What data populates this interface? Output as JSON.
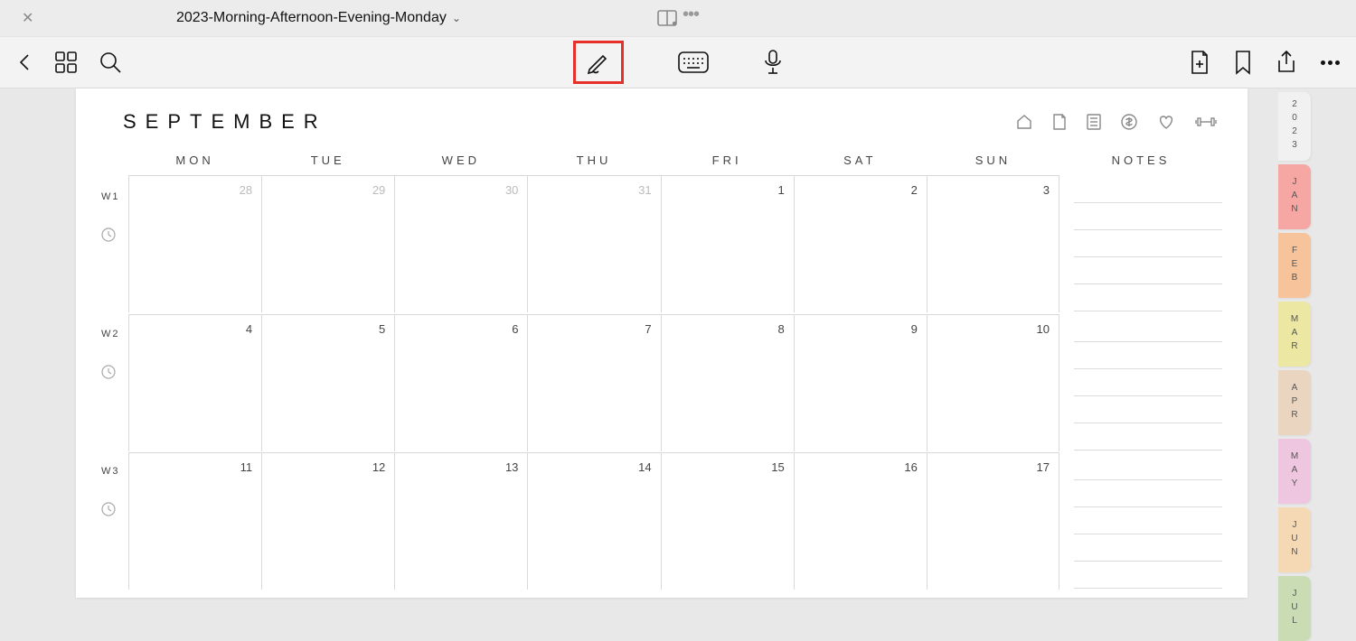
{
  "titlebar": {
    "doc_title": "2023-Morning-Afternoon-Evening-Monday"
  },
  "page": {
    "month_title": "SEPTEMBER",
    "day_headers": [
      "MON",
      "TUE",
      "WED",
      "THU",
      "FRI",
      "SAT",
      "SUN",
      "NOTES"
    ],
    "weeks": [
      {
        "label": "W1",
        "days": [
          {
            "n": "28",
            "prev": true
          },
          {
            "n": "29",
            "prev": true
          },
          {
            "n": "30",
            "prev": true
          },
          {
            "n": "31",
            "prev": true
          },
          {
            "n": "1"
          },
          {
            "n": "2"
          },
          {
            "n": "3"
          }
        ]
      },
      {
        "label": "W2",
        "days": [
          {
            "n": "4"
          },
          {
            "n": "5"
          },
          {
            "n": "6"
          },
          {
            "n": "7"
          },
          {
            "n": "8"
          },
          {
            "n": "9"
          },
          {
            "n": "10"
          }
        ]
      },
      {
        "label": "W3",
        "days": [
          {
            "n": "11"
          },
          {
            "n": "12"
          },
          {
            "n": "13"
          },
          {
            "n": "14"
          },
          {
            "n": "15"
          },
          {
            "n": "16"
          },
          {
            "n": "17"
          }
        ]
      }
    ]
  },
  "tabs": {
    "year": "2023",
    "months": [
      {
        "label": "JAN",
        "color": "#f6a7a4"
      },
      {
        "label": "FEB",
        "color": "#f7c39a"
      },
      {
        "label": "MAR",
        "color": "#ede7a4"
      },
      {
        "label": "APR",
        "color": "#e9d5c0"
      },
      {
        "label": "MAY",
        "color": "#eec6df"
      },
      {
        "label": "JUN",
        "color": "#f5d9b5"
      },
      {
        "label": "JUL",
        "color": "#c9dcb3"
      }
    ]
  }
}
